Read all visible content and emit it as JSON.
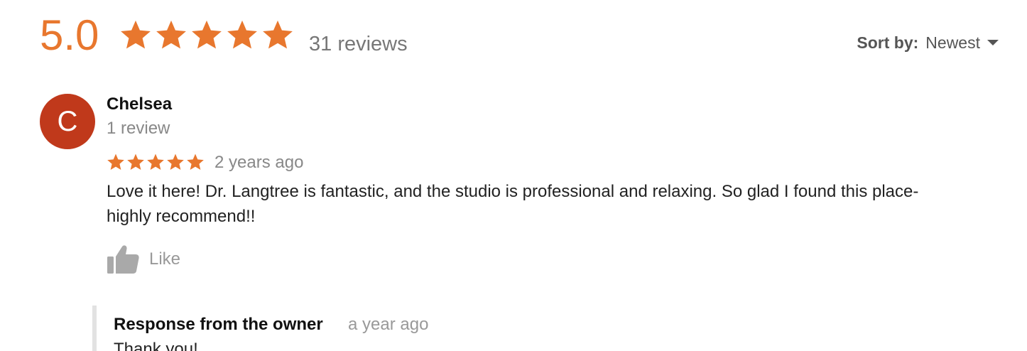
{
  "summary": {
    "score": "5.0",
    "rating": 5,
    "max_rating": 5,
    "review_count_label": "31 reviews"
  },
  "sort": {
    "label": "Sort by:",
    "value": "Newest"
  },
  "review": {
    "avatar_letter": "C",
    "reviewer_name": "Chelsea",
    "reviewer_review_count": "1 review",
    "rating": 5,
    "time": "2 years ago",
    "text": "Love it here! Dr. Langtree is fantastic, and the studio is professional and relaxing. So glad I found this place- highly recommend!!",
    "like_label": "Like"
  },
  "owner_response": {
    "title": "Response from the owner",
    "time": "a year ago",
    "text": "Thank you!"
  },
  "colors": {
    "accent": "#e8772e",
    "avatar_bg": "#c0391b",
    "muted_text": "#888888"
  }
}
